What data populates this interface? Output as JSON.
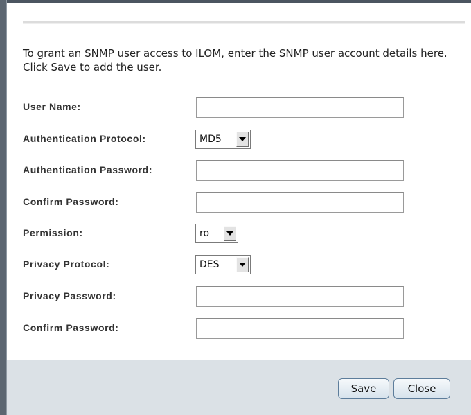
{
  "intro_text": "To grant an SNMP user access to ILOM, enter the SNMP user account details here. Click Save to add the user.",
  "form": {
    "user_name": {
      "label": "User Name:",
      "value": ""
    },
    "auth_protocol": {
      "label": "Authentication Protocol:",
      "value": "MD5"
    },
    "auth_password": {
      "label": "Authentication Password:",
      "value": ""
    },
    "confirm_auth_password": {
      "label": "Confirm Password:",
      "value": ""
    },
    "permission": {
      "label": "Permission:",
      "value": "ro"
    },
    "privacy_protocol": {
      "label": "Privacy Protocol:",
      "value": "DES"
    },
    "privacy_password": {
      "label": "Privacy Password:",
      "value": ""
    },
    "confirm_privacy_password": {
      "label": "Confirm Password:",
      "value": ""
    }
  },
  "buttons": {
    "save": "Save",
    "close": "Close"
  },
  "colors": {
    "footer_bg": "#dbe1e6",
    "button_border": "#5d7d9b"
  }
}
